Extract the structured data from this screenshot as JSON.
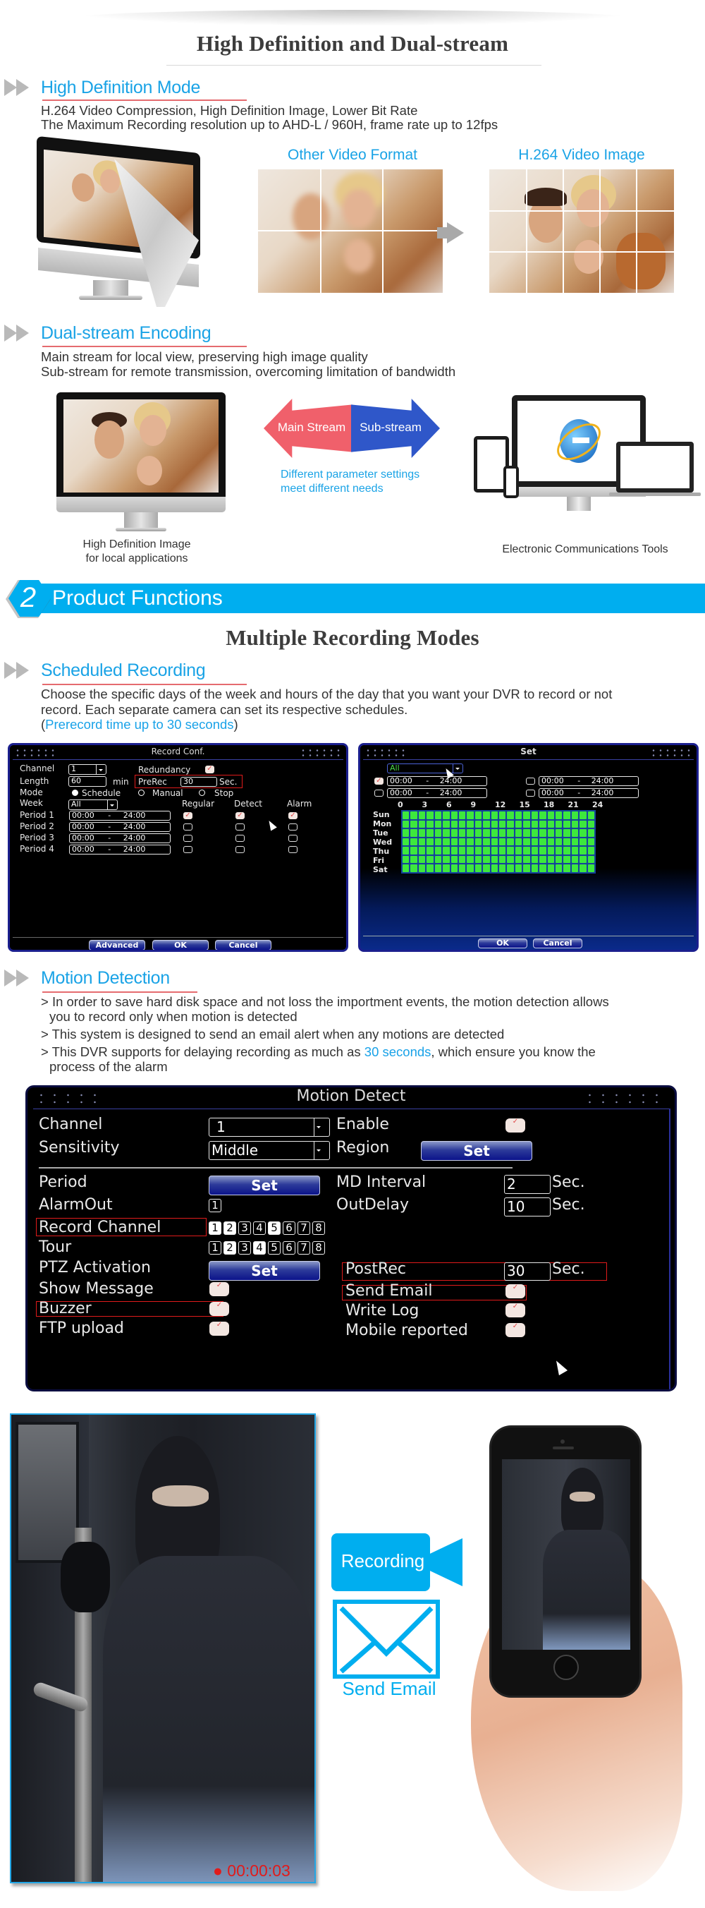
{
  "hd_section": {
    "title": "High Definition and Dual-stream",
    "hd_mode": {
      "heading": "High Definition Mode",
      "lines": [
        "H.264 Video Compression, High Definition Image, Lower Bit Rate",
        "The Maximum Recording resolution up to AHD-L / 960H, frame rate up to 12fps"
      ],
      "compare_left_label": "Other Video Format",
      "compare_right_label": "H.264 Video Image",
      "arrow_icon": "right-arrow-icon"
    },
    "dual_stream": {
      "heading": "Dual-stream Encoding",
      "lines": [
        "Main stream for local view, preserving high image quality",
        "Sub-stream for remote transmission, overcoming limitation of bandwidth"
      ],
      "main_stream_label": "Main Stream",
      "sub_stream_label": "Sub-stream",
      "parameter_note_1": "Different parameter settings",
      "parameter_note_2": "meet different needs",
      "left_caption_1": "High Definition Image",
      "left_caption_2": "for local applications",
      "right_caption": "Electronic Communications Tools"
    }
  },
  "banner": {
    "number": "2",
    "title": "Product Functions",
    "color": "#00aeef"
  },
  "recording_modes": {
    "title": "Multiple Recording Modes",
    "scheduled": {
      "heading": "Scheduled Recording",
      "line1": "Choose the specific days of the week and hours of the day that you want your DVR to record or not",
      "line2": "record. Each separate camera can set its respective schedules.",
      "note_open": "(",
      "note": "Prerecord time up to 30 seconds",
      "note_close": ")"
    }
  },
  "record_conf": {
    "title": "Record Conf.",
    "channel_label": "Channel",
    "channel_value": "1",
    "redundancy_label": "Redundancy",
    "redundancy_checked": true,
    "length_label": "Length",
    "length_value": "60",
    "length_unit": "min",
    "prerec_label": "PreRec",
    "prerec_value": "30",
    "prerec_unit": "Sec.",
    "mode_label": "Mode",
    "mode_options": [
      "Schedule",
      "Manual",
      "Stop"
    ],
    "mode_selected": "Schedule",
    "week_label": "Week",
    "week_value": "All",
    "col_regular": "Regular",
    "col_detect": "Detect",
    "col_alarm": "Alarm",
    "periods": [
      {
        "label": "Period 1",
        "start": "00:00",
        "sep": "-",
        "end": "24:00",
        "regular": true,
        "detect": true,
        "alarm": true
      },
      {
        "label": "Period 2",
        "start": "00:00",
        "sep": "-",
        "end": "24:00",
        "regular": false,
        "detect": false,
        "alarm": false
      },
      {
        "label": "Period 3",
        "start": "00:00",
        "sep": "-",
        "end": "24:00",
        "regular": false,
        "detect": false,
        "alarm": false
      },
      {
        "label": "Period 4",
        "start": "00:00",
        "sep": "-",
        "end": "24:00",
        "regular": false,
        "detect": false,
        "alarm": false
      }
    ],
    "buttons": {
      "advanced": "Advanced",
      "ok": "OK",
      "cancel": "Cancel"
    }
  },
  "schedule_set": {
    "title": "Set",
    "day_select": "All",
    "ranges": [
      {
        "checked": true,
        "start": "00:00",
        "sep": "-",
        "end": "24:00"
      },
      {
        "checked": false,
        "start": "00:00",
        "sep": "-",
        "end": "24:00"
      },
      {
        "checked": false,
        "start": "00:00",
        "sep": "-",
        "end": "24:00"
      },
      {
        "checked": false,
        "start": "00:00",
        "sep": "-",
        "end": "24:00"
      }
    ],
    "hour_ticks": [
      "0",
      "3",
      "6",
      "9",
      "12",
      "15",
      "18",
      "21",
      "24"
    ],
    "days": [
      "Sun",
      "Mon",
      "Tue",
      "Wed",
      "Thu",
      "Fri",
      "Sat"
    ],
    "all_hours_enabled": true,
    "buttons": {
      "ok": "OK",
      "cancel": "Cancel"
    }
  },
  "motion": {
    "heading": "Motion Detection",
    "bullet1a": "> In order to save hard disk space and not loss the importment events, the motion detection allows",
    "bullet1b": "you to record only when motion is detected",
    "bullet2": "> This system is designed to send an email alert when any motions are detected",
    "bullet3_pre": "> This DVR supports for delaying recording as much as ",
    "bullet3_highlight": "30 seconds",
    "bullet3_post": ", which ensure you know the",
    "bullet3b": "process of the alarm"
  },
  "motion_detect_panel": {
    "title": "Motion Detect",
    "channel_label": "Channel",
    "channel_value": "1",
    "enable_label": "Enable",
    "enable_checked": true,
    "sensitivity_label": "Sensitivity",
    "sensitivity_value": "Middle",
    "region_label": "Region",
    "region_button": "Set",
    "period_label": "Period",
    "period_button": "Set",
    "md_interval_label": "MD Interval",
    "md_interval_value": "2",
    "md_interval_unit": "Sec.",
    "alarmout_label": "AlarmOut",
    "alarmout_value": "1",
    "outdelay_label": "OutDelay",
    "outdelay_value": "10",
    "outdelay_unit": "Sec.",
    "record_channel_label": "Record Channel",
    "record_channels": [
      {
        "n": "1",
        "on": true
      },
      {
        "n": "2",
        "on": true
      },
      {
        "n": "3",
        "on": false
      },
      {
        "n": "4",
        "on": false
      },
      {
        "n": "5",
        "on": true
      },
      {
        "n": "6",
        "on": false
      },
      {
        "n": "7",
        "on": false
      },
      {
        "n": "8",
        "on": false
      }
    ],
    "tour_label": "Tour",
    "tour_channels": [
      {
        "n": "1",
        "on": false
      },
      {
        "n": "2",
        "on": true
      },
      {
        "n": "3",
        "on": false
      },
      {
        "n": "4",
        "on": true
      },
      {
        "n": "5",
        "on": false
      },
      {
        "n": "6",
        "on": false
      },
      {
        "n": "7",
        "on": false
      },
      {
        "n": "8",
        "on": false
      }
    ],
    "ptz_label": "PTZ Activation",
    "ptz_button": "Set",
    "postrec_label": "PostRec",
    "postrec_value": "30",
    "postrec_unit": "Sec.",
    "show_message_label": "Show Message",
    "show_message_checked": true,
    "send_email_label": "Send Email",
    "send_email_checked": true,
    "buzzer_label": "Buzzer",
    "buzzer_checked": true,
    "write_log_label": "Write Log",
    "write_log_checked": true,
    "ftp_label": "FTP upload",
    "ftp_checked": true,
    "mobile_label": "Mobile reported",
    "mobile_checked": true
  },
  "alert_demo": {
    "timer": "00:00:03",
    "recording_label": "Recording",
    "email_label": "Send Email",
    "rec_dot_color": "#e01b1b",
    "accent": "#00aeef"
  }
}
